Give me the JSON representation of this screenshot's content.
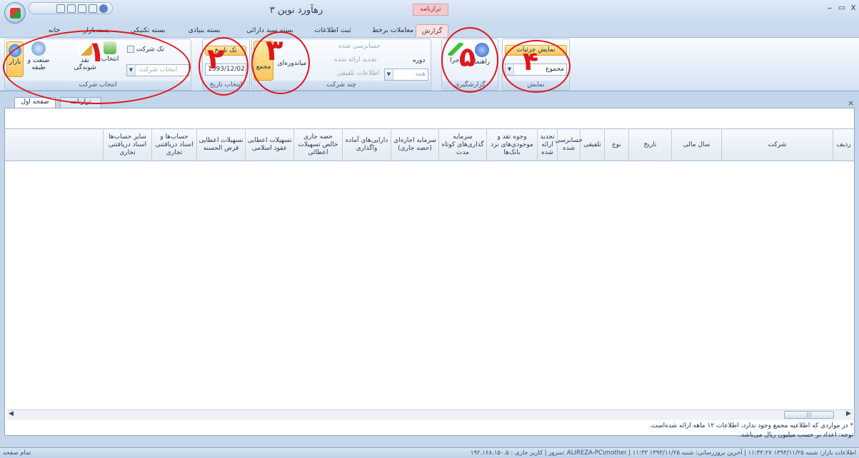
{
  "window": {
    "title": "رهآورد نوین ۳",
    "context_tab_header": "ترازنامه",
    "controls": {
      "minimize": "–",
      "maximize": "▭",
      "close": "x"
    }
  },
  "ribbon_tabs": [
    "گزارش",
    "معاملات برخط",
    "ثبت اطلاعات",
    "بسته سبد دارائی",
    "بسته بنیادی",
    "بسته تکنیکی",
    "بسته‌بازار",
    "خانه"
  ],
  "groups": {
    "company": {
      "label": "انتخاب شرکت",
      "buttons": [
        "بازار",
        "صنعت و طبقه",
        "نقد شوندگی",
        "انتخاب"
      ],
      "single_company": "تک شرکت",
      "combo_placeholder": "انتخاب شرکت"
    },
    "date": {
      "label": "انتخاب تاریخ",
      "single_date": "تک تاریخ",
      "date_value": "1393/12/02"
    },
    "multi_company": {
      "label": "چند شرکت",
      "options": [
        "حسابرسی شده",
        "تجدید ارائه شده",
        "اطلاعات تلفیقی"
      ],
      "buttons": [
        "میاندوره‌ای",
        "مجمع"
      ],
      "period_label": "دوره",
      "period_value": "همه"
    },
    "report": {
      "label": "گزارشگیری",
      "buttons": [
        "راهنما",
        "اجرا"
      ]
    },
    "display": {
      "label": "نمایش",
      "details_button": "نمایش جزئیات",
      "mode_value": "مجموع"
    }
  },
  "annotations": [
    "۱",
    "۲",
    "۳",
    "۴",
    "۵"
  ],
  "doc_tabs": [
    "صفحه اول",
    "ترازنامه"
  ],
  "columns": [
    "ردیف",
    "شرکت",
    "سال مالی",
    "تاریخ",
    "نوع",
    "تلفیقی",
    "حسابرسی شده",
    "تجدید ارائه شده",
    "وجوه نقد و موجودی‌های نزد بانک‌ها",
    "سرمایه گذاری‌های کوتاه مدت",
    "سرمایه اجاره‌ای (حصه جاری)",
    "دارایی‌های آماده واگذاری",
    "حصه جاری خالص تسهیلات اعطائی",
    "تسهیلات اعطایی عقود اسلامی",
    "تسهیلات اعطایی قرض الحسنه",
    "حساب‌ها و اسناد دریافتنی تجاری",
    "سایر حساب‌ها اسناد دریافتنی تجاری"
  ],
  "notes": [
    "* در مواردی که اطلاعیه مجمع وجود ندارد، اطلاعات ۱۲ ماهه ارائه شده‌است.",
    "توجه: اعداد بر حسب میلیون ریال می‌باشد."
  ],
  "status": {
    "left": "تمام صفحه",
    "right": "۱۹۲.۱۶۸.۱۵۰.۵ : سرور  |  کاربر جاری: ALIREZA-PC\\mother  |  اطلاعات بازار: شنبه ۱۳۹۳/۱۱/۲۵ ۱۱:۳۴:۲۷  |  آخرین بروزرسانی: شنبه ۱۳۹۳/۱۱/۲۵ ۱۱:۳۳"
  }
}
